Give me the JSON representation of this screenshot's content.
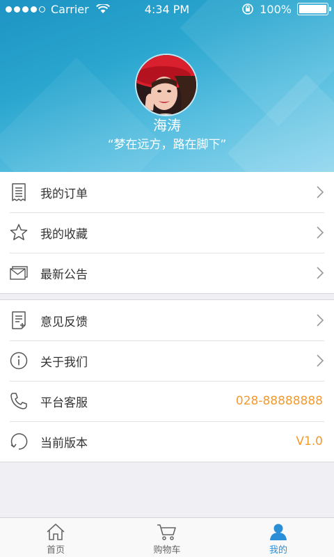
{
  "status_bar": {
    "carrier": "Carrier",
    "time": "4:34 PM",
    "battery": "100%"
  },
  "profile": {
    "username": "海涛",
    "motto": "“梦在远方，路在脚下”"
  },
  "menu_group_1": [
    {
      "label": "我的订单",
      "icon": "receipt-icon"
    },
    {
      "label": "我的收藏",
      "icon": "star-icon"
    },
    {
      "label": "最新公告",
      "icon": "mail-icon"
    }
  ],
  "menu_group_2": [
    {
      "label": "意见反馈",
      "icon": "feedback-icon"
    },
    {
      "label": "关于我们",
      "icon": "info-icon"
    },
    {
      "label": "平台客服",
      "icon": "phone-icon",
      "value": "028-88888888"
    },
    {
      "label": "当前版本",
      "icon": "refresh-icon",
      "value": "V1.0"
    }
  ],
  "tabbar": {
    "items": [
      {
        "label": "首页",
        "icon": "home-icon"
      },
      {
        "label": "购物车",
        "icon": "cart-icon"
      },
      {
        "label": "我的",
        "icon": "user-icon",
        "active": true
      }
    ]
  },
  "colors": {
    "header": "#2aa6cf",
    "accent_value": "#f39a2e",
    "tab_active": "#2a8fd6"
  }
}
